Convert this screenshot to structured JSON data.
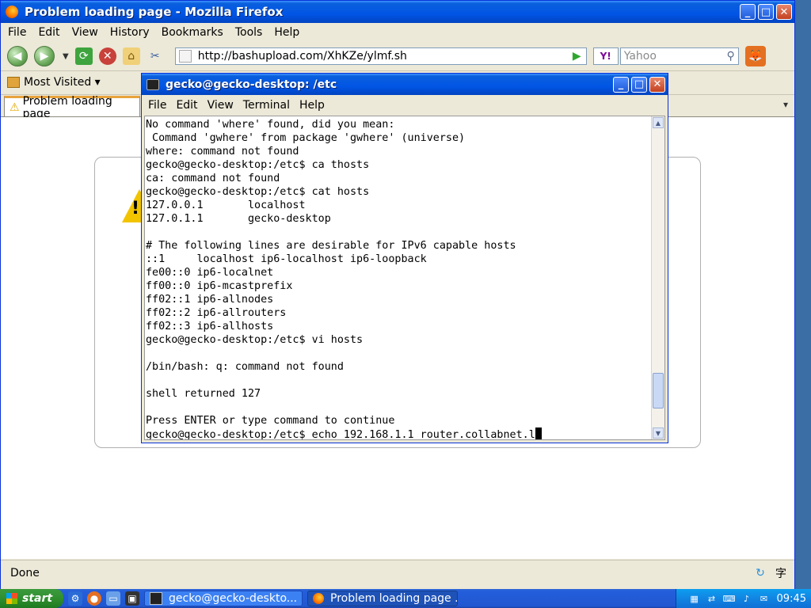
{
  "firefox": {
    "title": "Problem loading page - Mozilla Firefox",
    "menu": [
      "File",
      "Edit",
      "View",
      "History",
      "Bookmarks",
      "Tools",
      "Help"
    ],
    "url": "http://bashupload.com/XhKZe/ylmf.sh",
    "search_placeholder": "Yahoo",
    "search_engine_label": "Y!",
    "bookmarks_label": "Most Visited ▾",
    "tab_label": "Problem loading page",
    "status": "Done",
    "status_ime": "字"
  },
  "terminal": {
    "title": "gecko@gecko-desktop: /etc",
    "menu": [
      "File",
      "Edit",
      "View",
      "Terminal",
      "Help"
    ],
    "lines": [
      "No command 'where' found, did you mean:",
      " Command 'gwhere' from package 'gwhere' (universe)",
      "where: command not found",
      "gecko@gecko-desktop:/etc$ ca thosts",
      "ca: command not found",
      "gecko@gecko-desktop:/etc$ cat hosts",
      "127.0.0.1       localhost",
      "127.0.1.1       gecko-desktop",
      "",
      "# The following lines are desirable for IPv6 capable hosts",
      "::1     localhost ip6-localhost ip6-loopback",
      "fe00::0 ip6-localnet",
      "ff00::0 ip6-mcastprefix",
      "ff02::1 ip6-allnodes",
      "ff02::2 ip6-allrouters",
      "ff02::3 ip6-allhosts",
      "gecko@gecko-desktop:/etc$ vi hosts",
      "",
      "/bin/bash: q: command not found",
      "",
      "shell returned 127",
      "",
      "Press ENTER or type command to continue"
    ],
    "prompt_line": "gecko@gecko-desktop:/etc$ echo 192.168.1.1 router.collabnet.l",
    "scroll_position": 0.93
  },
  "taskbar": {
    "start_label": "start",
    "tasks": [
      {
        "label": "gecko@gecko-deskto...",
        "active": false
      },
      {
        "label": "Problem loading page ...",
        "active": true
      }
    ],
    "clock": "09:45"
  },
  "colors": {
    "titlebar": "#0155e5",
    "taskbar": "#245edb",
    "start": "#2f8f2f"
  }
}
